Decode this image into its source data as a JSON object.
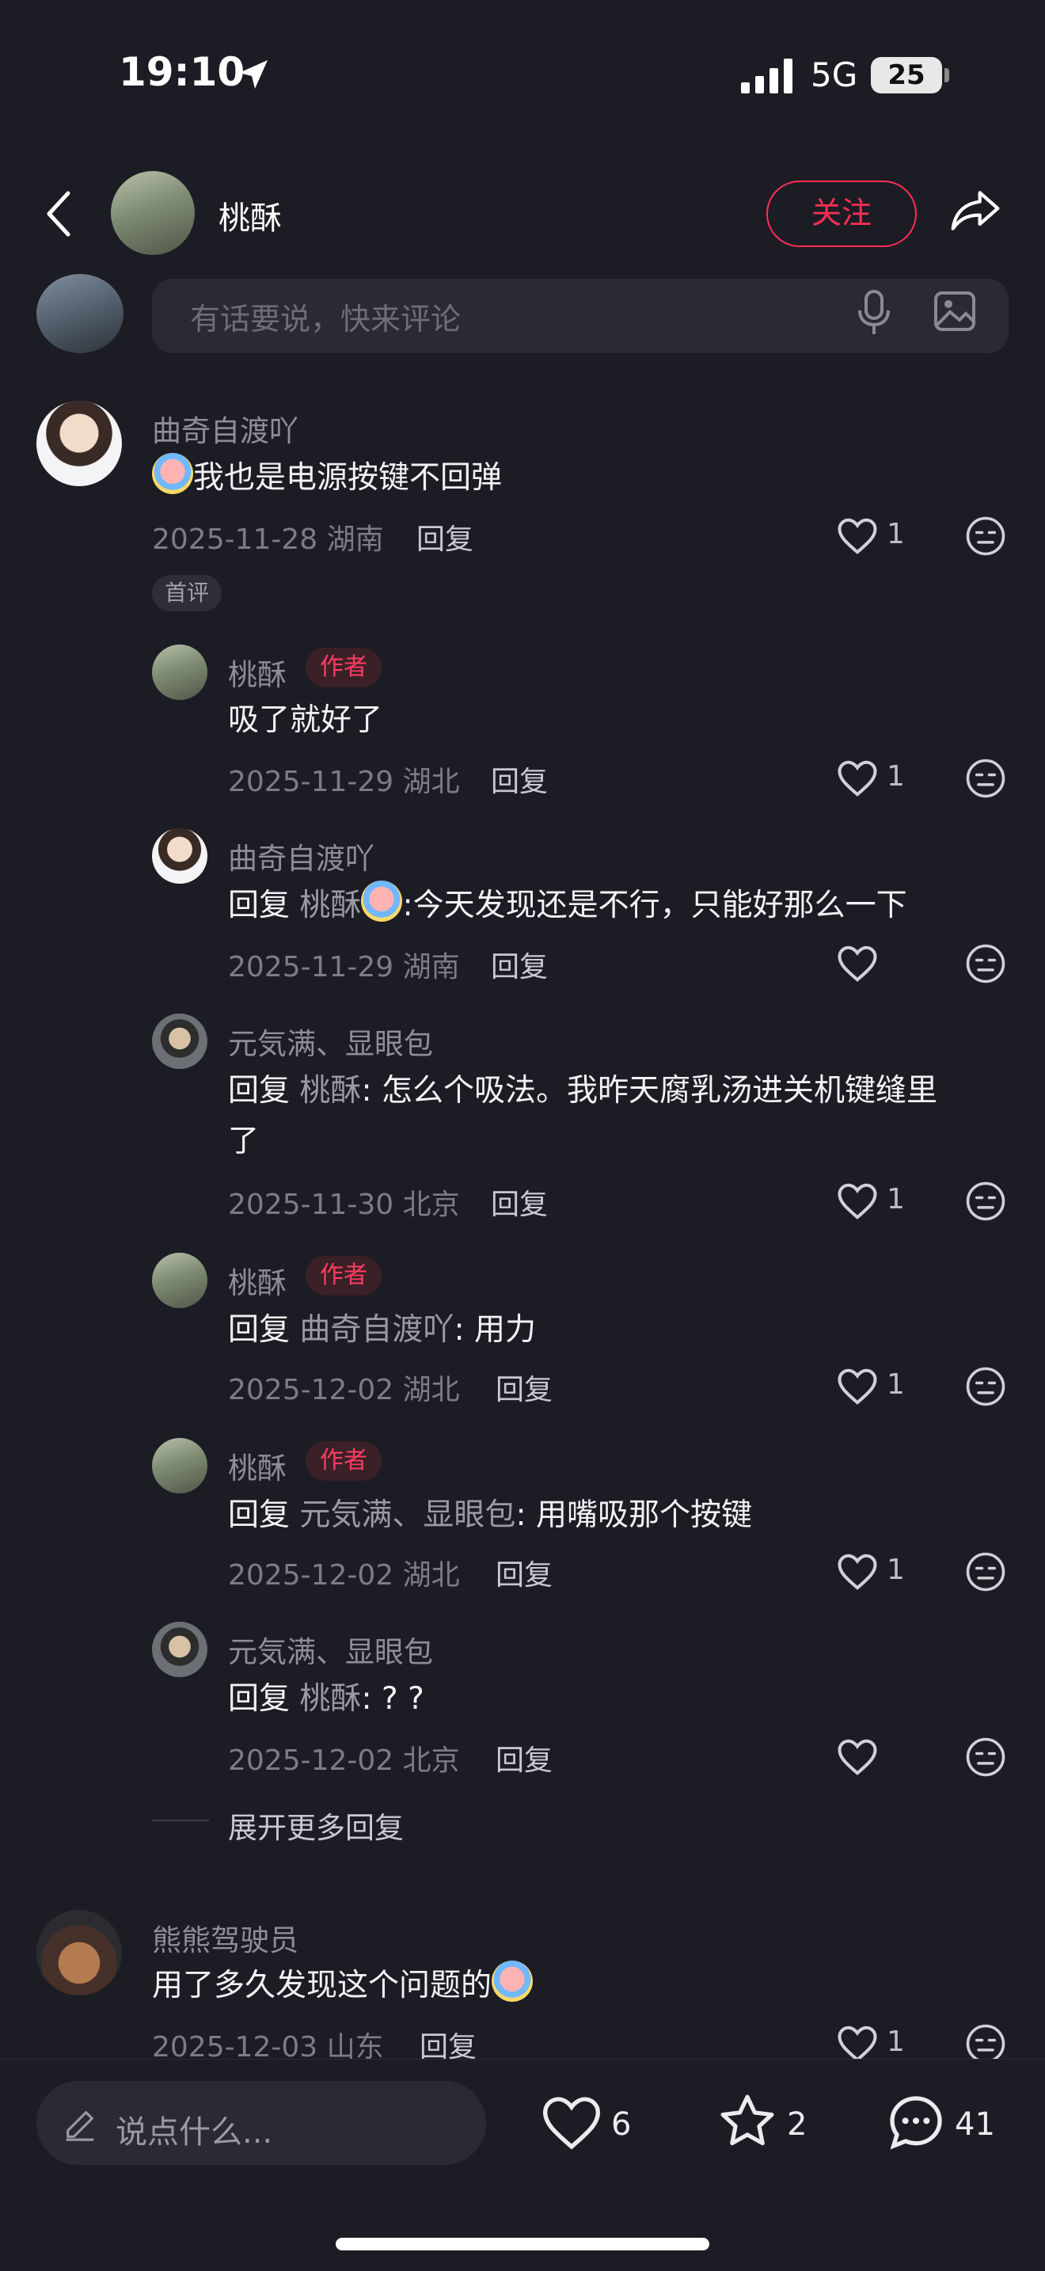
{
  "status_bar": {
    "time": "19:10",
    "network": "5G",
    "battery": "25"
  },
  "header": {
    "title": "桃酥",
    "follow_label": "关注"
  },
  "comment_input": {
    "placeholder": "有话要说，快来评论"
  },
  "comments": [
    {
      "user": "曲奇自渡吖",
      "text": "我也是电源按键不回弹",
      "date": "2025-11-28",
      "location": "湖南",
      "reply_label": "回复",
      "likes": "1",
      "tag": "首评"
    },
    {
      "user": "熊熊驾驶员",
      "text": "用了多久发现这个问题的",
      "date": "2025-12-03",
      "location": "山东",
      "reply_label": "回复",
      "likes": "1"
    }
  ],
  "replies": [
    {
      "user": "桃酥",
      "author_tag": "作者",
      "text": "吸了就好了",
      "date": "2025-11-29",
      "location": "湖北",
      "reply_label": "回复",
      "likes": "1"
    },
    {
      "user": "曲奇自渡吖",
      "prefix": "回复",
      "reply_to": "桃酥",
      "text": ":今天发现还是不行，只能好那么一下",
      "date": "2025-11-29",
      "location": "湖南",
      "reply_label": "回复",
      "likes": ""
    },
    {
      "user": "元気满、显眼包",
      "prefix": "回复",
      "reply_to": "桃酥",
      "text": ": 怎么个吸法。我昨天腐乳汤进关机键缝里",
      "text_cont": "了",
      "date": "2025-11-30",
      "location": "北京",
      "reply_label": "回复",
      "likes": "1"
    },
    {
      "user": "桃酥",
      "author_tag": "作者",
      "prefix": "回复",
      "reply_to": "曲奇自渡吖",
      "text": ": 用力",
      "date": "2025-12-02",
      "location": "湖北",
      "reply_label": "回复",
      "likes": "1"
    },
    {
      "user": "桃酥",
      "author_tag": "作者",
      "prefix": "回复",
      "reply_to": "元気满、显眼包",
      "text": ": 用嘴吸那个按键",
      "date": "2025-12-02",
      "location": "湖北",
      "reply_label": "回复",
      "likes": "1"
    },
    {
      "user": "元気满、显眼包",
      "prefix": "回复",
      "reply_to": "桃酥",
      "text": ": ? ?",
      "date": "2025-12-02",
      "location": "北京",
      "reply_label": "回复",
      "likes": ""
    }
  ],
  "expand_label": "展开更多回复",
  "bottom_bar": {
    "say_placeholder": "说点什么...",
    "likes": "6",
    "favorites": "2",
    "comments": "41"
  },
  "colors": {
    "accent": "#ff2e55",
    "background": "#1c1c24"
  }
}
